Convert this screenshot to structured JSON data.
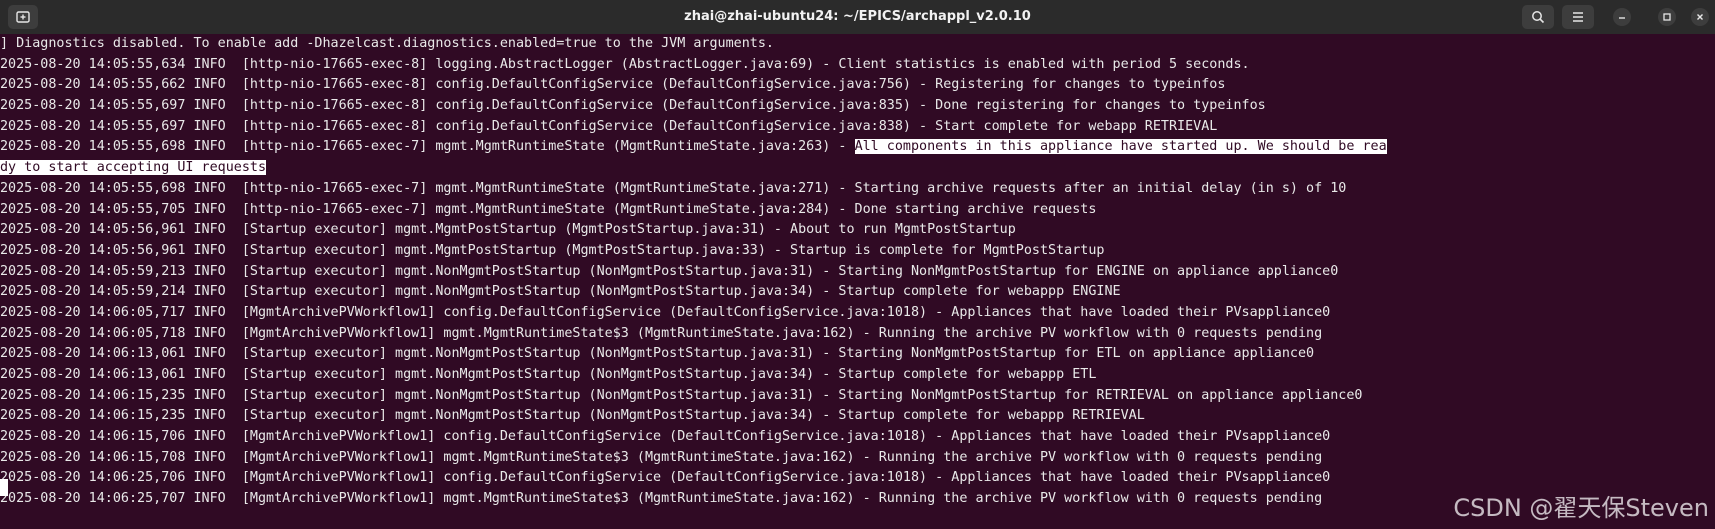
{
  "window": {
    "title": "zhai@zhai-ubuntu24: ~/EPICS/archappl_v2.0.10"
  },
  "colors": {
    "background": "#300a24",
    "titlebar": "#2b2b2b",
    "text": "#e9e9e9",
    "selection": "#ffffff"
  },
  "icons": {
    "new_tab": "new-tab-icon",
    "search": "search-icon",
    "menu": "hamburger-menu-icon",
    "minimize": "minimize-icon",
    "maximize": "maximize-icon",
    "close": "close-icon"
  },
  "terminal": {
    "lines": [
      "] Diagnostics disabled. To enable add -Dhazelcast.diagnostics.enabled=true to the JVM arguments.",
      "2025-08-20 14:05:55,634 INFO  [http-nio-17665-exec-8] logging.AbstractLogger (AbstractLogger.java:69) - Client statistics is enabled with period 5 seconds.",
      "2025-08-20 14:05:55,662 INFO  [http-nio-17665-exec-8] config.DefaultConfigService (DefaultConfigService.java:756) - Registering for changes to typeinfos",
      "2025-08-20 14:05:55,697 INFO  [http-nio-17665-exec-8] config.DefaultConfigService (DefaultConfigService.java:835) - Done registering for changes to typeinfos",
      "2025-08-20 14:05:55,697 INFO  [http-nio-17665-exec-8] config.DefaultConfigService (DefaultConfigService.java:838) - Start complete for webapp RETRIEVAL"
    ],
    "highlight_prefix": "2025-08-20 14:05:55,698 INFO  [http-nio-17665-exec-7] mgmt.MgmtRuntimeState (MgmtRuntimeState.java:263) - ",
    "highlight_part1": "All components in this appliance have started up. We should be rea",
    "highlight_part2": "dy to start accepting UI requests",
    "lines_after": [
      "2025-08-20 14:05:55,698 INFO  [http-nio-17665-exec-7] mgmt.MgmtRuntimeState (MgmtRuntimeState.java:271) - Starting archive requests after an initial delay (in s) of 10",
      "2025-08-20 14:05:55,705 INFO  [http-nio-17665-exec-7] mgmt.MgmtRuntimeState (MgmtRuntimeState.java:284) - Done starting archive requests",
      "2025-08-20 14:05:56,961 INFO  [Startup executor] mgmt.MgmtPostStartup (MgmtPostStartup.java:31) - About to run MgmtPostStartup",
      "2025-08-20 14:05:56,961 INFO  [Startup executor] mgmt.MgmtPostStartup (MgmtPostStartup.java:33) - Startup is complete for MgmtPostStartup",
      "2025-08-20 14:05:59,213 INFO  [Startup executor] mgmt.NonMgmtPostStartup (NonMgmtPostStartup.java:31) - Starting NonMgmtPostStartup for ENGINE on appliance appliance0",
      "2025-08-20 14:05:59,214 INFO  [Startup executor] mgmt.NonMgmtPostStartup (NonMgmtPostStartup.java:34) - Startup complete for webappp ENGINE",
      "2025-08-20 14:06:05,717 INFO  [MgmtArchivePVWorkflow1] config.DefaultConfigService (DefaultConfigService.java:1018) - Appliances that have loaded their PVsappliance0",
      "2025-08-20 14:06:05,718 INFO  [MgmtArchivePVWorkflow1] mgmt.MgmtRuntimeState$3 (MgmtRuntimeState.java:162) - Running the archive PV workflow with 0 requests pending",
      "2025-08-20 14:06:13,061 INFO  [Startup executor] mgmt.NonMgmtPostStartup (NonMgmtPostStartup.java:31) - Starting NonMgmtPostStartup for ETL on appliance appliance0",
      "2025-08-20 14:06:13,061 INFO  [Startup executor] mgmt.NonMgmtPostStartup (NonMgmtPostStartup.java:34) - Startup complete for webappp ETL",
      "2025-08-20 14:06:15,235 INFO  [Startup executor] mgmt.NonMgmtPostStartup (NonMgmtPostStartup.java:31) - Starting NonMgmtPostStartup for RETRIEVAL on appliance appliance0",
      "2025-08-20 14:06:15,235 INFO  [Startup executor] mgmt.NonMgmtPostStartup (NonMgmtPostStartup.java:34) - Startup complete for webappp RETRIEVAL",
      "2025-08-20 14:06:15,706 INFO  [MgmtArchivePVWorkflow1] config.DefaultConfigService (DefaultConfigService.java:1018) - Appliances that have loaded their PVsappliance0",
      "2025-08-20 14:06:15,708 INFO  [MgmtArchivePVWorkflow1] mgmt.MgmtRuntimeState$3 (MgmtRuntimeState.java:162) - Running the archive PV workflow with 0 requests pending",
      "2025-08-20 14:06:25,706 INFO  [MgmtArchivePVWorkflow1] config.DefaultConfigService (DefaultConfigService.java:1018) - Appliances that have loaded their PVsappliance0",
      "2025-08-20 14:06:25,707 INFO  [MgmtArchivePVWorkflow1] mgmt.MgmtRuntimeState$3 (MgmtRuntimeState.java:162) - Running the archive PV workflow with 0 requests pending"
    ]
  },
  "watermark": "CSDN @翟天保Steven"
}
